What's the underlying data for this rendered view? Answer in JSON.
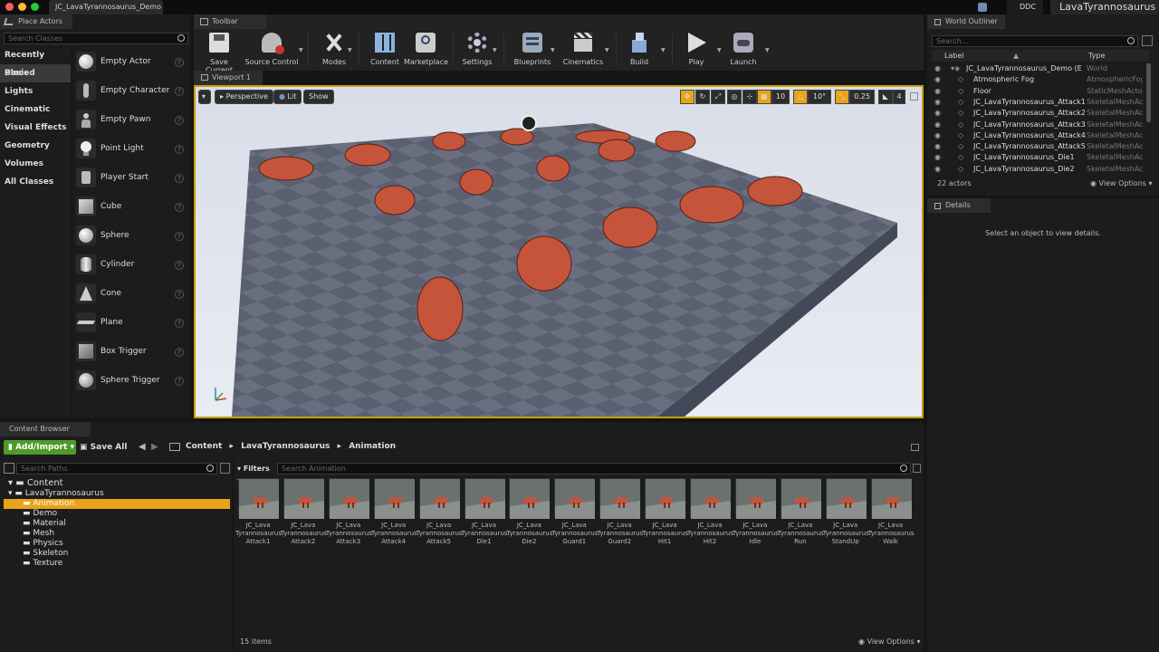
{
  "window": {
    "document_tab": "JC_LavaTyrannosaurus_Demo",
    "ddc": "DDC",
    "project": "LavaTyrannosaurus"
  },
  "place_actors": {
    "title": "Place Actors",
    "search_placeholder": "Search Classes",
    "categories": [
      "Recently Placed",
      "Basic",
      "Lights",
      "Cinematic",
      "Visual Effects",
      "Geometry",
      "Volumes",
      "All Classes"
    ],
    "items": [
      "Empty Actor",
      "Empty Character",
      "Empty Pawn",
      "Point Light",
      "Player Start",
      "Cube",
      "Sphere",
      "Cylinder",
      "Cone",
      "Plane",
      "Box Trigger",
      "Sphere Trigger"
    ]
  },
  "toolbar": {
    "title": "Toolbar",
    "buttons": [
      "Save Current",
      "Source Control",
      "Modes",
      "Content",
      "Marketplace",
      "Settings",
      "Blueprints",
      "Cinematics",
      "Build",
      "Play",
      "Launch"
    ]
  },
  "viewport": {
    "tab": "Viewport 1",
    "perspective": "Perspective",
    "lit": "Lit",
    "show": "Show",
    "grid_snap": "10",
    "rot_snap": "10°",
    "scale_snap": "0.25",
    "cam_speed": "4"
  },
  "outliner": {
    "title": "World Outliner",
    "search_placeholder": "Search...",
    "col_label": "Label",
    "col_type": "Type",
    "rows": [
      {
        "label": "JC_LavaTyrannosaurus_Demo (Edito",
        "type": "World"
      },
      {
        "label": "Atmospheric Fog",
        "type": "AtmosphericFog"
      },
      {
        "label": "Floor",
        "type": "StaticMeshActor"
      },
      {
        "label": "JC_LavaTyrannosaurus_Attack1",
        "type": "SkeletalMeshActo"
      },
      {
        "label": "JC_LavaTyrannosaurus_Attack2",
        "type": "SkeletalMeshActo"
      },
      {
        "label": "JC_LavaTyrannosaurus_Attack3",
        "type": "SkeletalMeshActo"
      },
      {
        "label": "JC_LavaTyrannosaurus_Attack4",
        "type": "SkeletalMeshActo"
      },
      {
        "label": "JC_LavaTyrannosaurus_Attack5",
        "type": "SkeletalMeshActo"
      },
      {
        "label": "JC_LavaTyrannosaurus_Die1",
        "type": "SkeletalMeshActo"
      },
      {
        "label": "JC_LavaTyrannosaurus_Die2",
        "type": "SkeletalMeshActo"
      }
    ],
    "count": "22 actors",
    "view_options": "View Options"
  },
  "details": {
    "title": "Details",
    "empty_text": "Select an object to view details."
  },
  "content_browser": {
    "title": "Content Browser",
    "add_import": "Add/Import",
    "save_all": "Save All",
    "breadcrumb": [
      "Content",
      "LavaTyrannosaurus",
      "Animation"
    ],
    "search_paths": "Search Paths",
    "filters": "Filters",
    "search_placeholder": "Search Animation",
    "tree": [
      "Content",
      "LavaTyrannosaurus",
      "Animation",
      "Demo",
      "Material",
      "Mesh",
      "Physics",
      "Skeleton",
      "Texture"
    ],
    "assets": [
      [
        "JC_Lava",
        "Tyrannosaurus",
        "Attack1"
      ],
      [
        "JC_Lava",
        "Tyrannosaurus",
        "Attack2"
      ],
      [
        "JC_Lava",
        "Tyrannosaurus",
        "Attack3"
      ],
      [
        "JC_Lava",
        "Tyrannosaurus",
        "Attack4"
      ],
      [
        "JC_Lava",
        "Tyrannosaurus",
        "Attack5"
      ],
      [
        "JC_Lava",
        "Tyrannosaurus",
        "Die1"
      ],
      [
        "JC_Lava",
        "Tyrannosaurus",
        "Die2"
      ],
      [
        "JC_Lava",
        "Tyrannosaurus",
        "Guard1"
      ],
      [
        "JC_Lava",
        "Tyrannosaurus",
        "Guard2"
      ],
      [
        "JC_Lava",
        "Tyrannosaurus",
        "Hit1"
      ],
      [
        "JC_Lava",
        "Tyrannosaurus",
        "Hit2"
      ],
      [
        "JC_Lava",
        "Tyrannosaurus",
        "Idle"
      ],
      [
        "JC_Lava",
        "Tyrannosaurus",
        "Run"
      ],
      [
        "JC_Lava",
        "Tyrannosaurus",
        "StandUp"
      ],
      [
        "JC_Lava",
        "Tyrannosaurus",
        "Walk"
      ]
    ],
    "item_count": "15 items",
    "view_options": "View Options"
  },
  "colors": {
    "accent": "#e8a317",
    "add_import_green": "#4e9a2a",
    "selected_folder": "#e8a317"
  }
}
